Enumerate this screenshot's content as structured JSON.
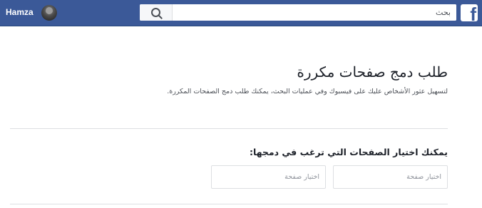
{
  "header": {
    "user_name": "Hamza",
    "search": {
      "placeholder": "بحث"
    },
    "logo_letter": "f",
    "brand_color": "#3b5998"
  },
  "main": {
    "title": "طلب دمج صفحات مكررة",
    "subtitle": "لتسهيل عثور الأشخاص عليك على فيسبوك وفي عمليات البحث، يمكنك طلب دمج الصفحات المكررة.",
    "section_label": "يمكنك اختيار الصفحات التي ترغب في دمجها:",
    "page_picker_1": {
      "placeholder": "اختيار صفحة"
    },
    "page_picker_2": {
      "placeholder": "اختيار صفحة"
    }
  },
  "icons": {
    "logo": "facebook-logo-icon",
    "search": "search-icon",
    "avatar": "avatar"
  }
}
